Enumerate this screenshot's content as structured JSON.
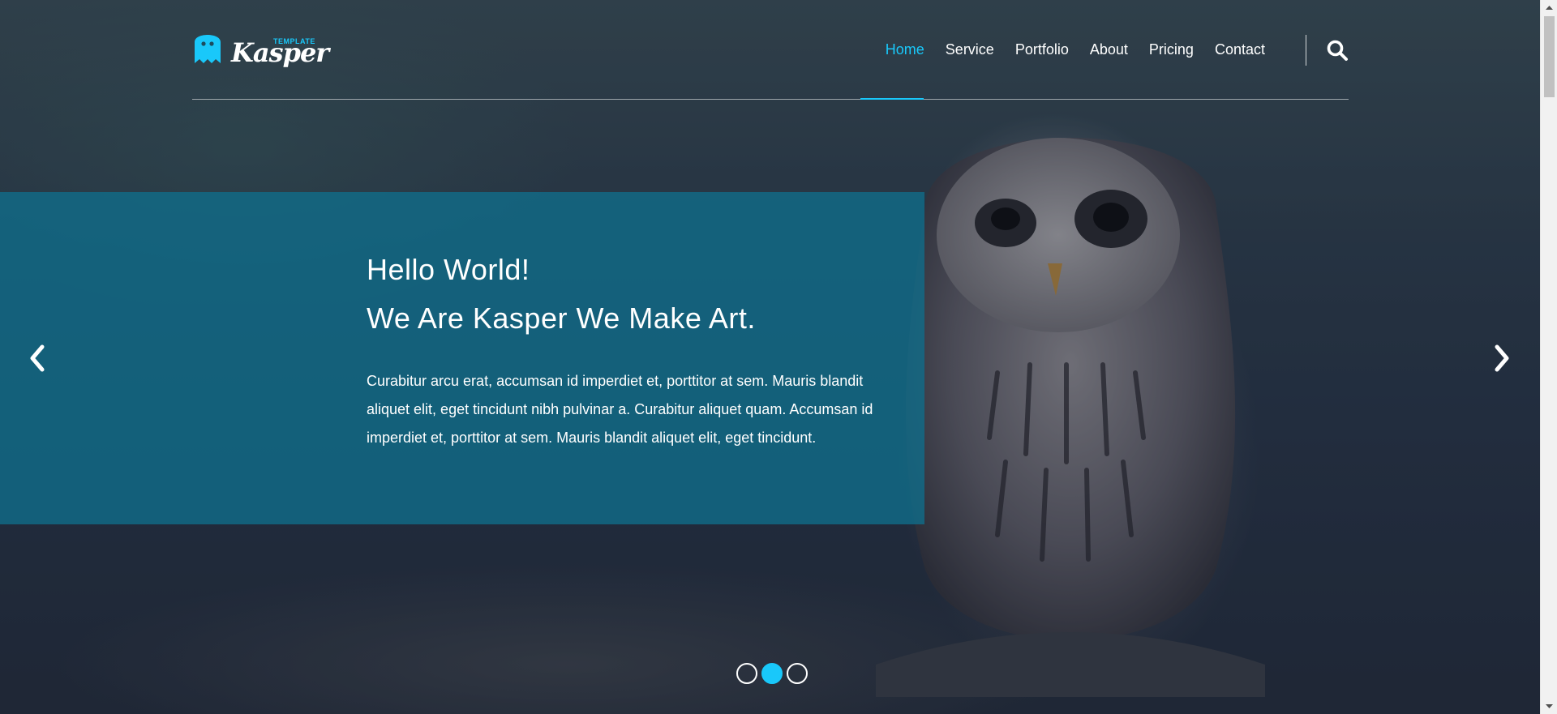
{
  "logo": {
    "tag": "TEMPLATE",
    "word": "Kasper"
  },
  "nav": {
    "items": [
      {
        "label": "Home",
        "active": true
      },
      {
        "label": "Service"
      },
      {
        "label": "Portfolio"
      },
      {
        "label": "About"
      },
      {
        "label": "Pricing"
      },
      {
        "label": "Contact"
      }
    ],
    "search_icon": "search-icon"
  },
  "slide": {
    "title_line1": "Hello World!",
    "title_line2": "We Are Kasper We Make Art.",
    "text": "Curabitur arcu erat, accumsan id imperdiet et, porttitor at sem. Mauris blandit aliquet elit, eget tincidunt nibh pulvinar a. Curabitur aliquet quam. Accumsan id imperdiet et, porttitor at sem. Mauris blandit aliquet elit, eget tincidunt."
  },
  "carousel": {
    "bullet_count": 3,
    "active_index": 1
  },
  "colors": {
    "accent": "#19c8fa",
    "panel": "#106d89"
  }
}
